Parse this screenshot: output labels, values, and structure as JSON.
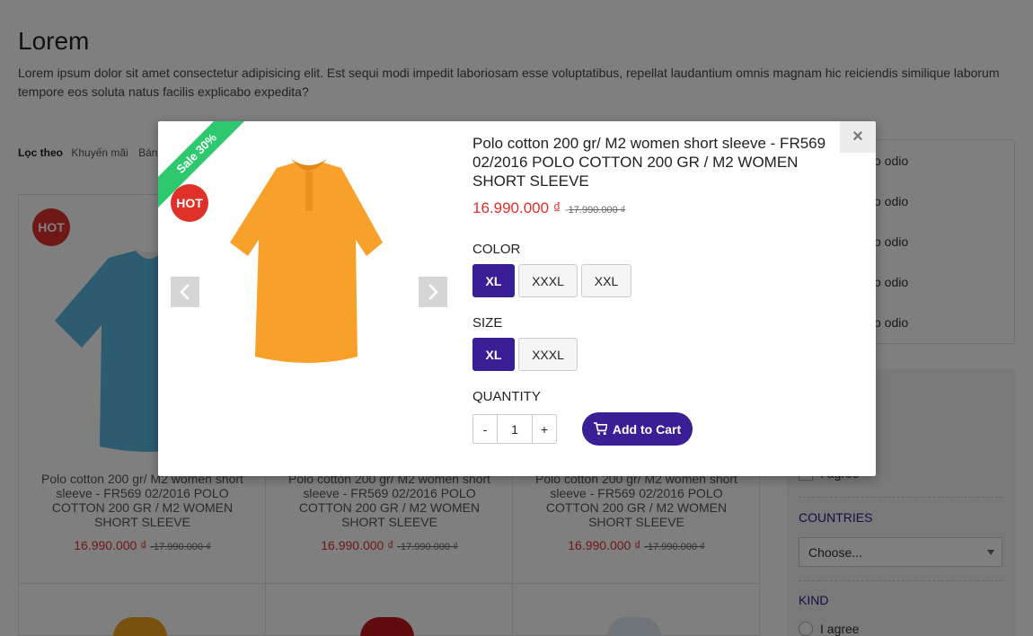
{
  "page": {
    "title": "Lorem",
    "description": "Lorem ipsum dolor sit amet consectetur adipisicing elit. Est sequi modi impedit laboriosam esse voluptatibus, repellat laudantium omnis magnam hic reiciendis similique laborum tempore eos soluta natus facilis explicabo expedita?"
  },
  "filter": {
    "label": "Lọc theo",
    "items": [
      "Khuyến mãi",
      "Bán c"
    ]
  },
  "products": [
    {
      "badge": "HOT",
      "name": "Polo cotton 200 gr/ M2 women short sleeve - FR569 02/2016 POLO COTTON 200 GR / M2 WOMEN SHORT SLEEVE",
      "price": "16.990.000 ₫",
      "sep": "-",
      "old_price": "17.990.000 ₫",
      "color": "#5bb7e0"
    },
    {
      "badge": "",
      "name": "Polo cotton 200 gr/ M2 women short sleeve - FR569 02/2016 POLO COTTON 200 GR / M2 WOMEN SHORT SLEEVE",
      "price": "16.990.000 ₫",
      "sep": "-",
      "old_price": "17.990.000 ₫",
      "color": "#cccccc"
    },
    {
      "badge": "",
      "name": "Polo cotton 200 gr/ M2 women short sleeve - FR569 02/2016 POLO COTTON 200 GR / M2 WOMEN SHORT SLEEVE",
      "price": "16.990.000 ₫",
      "sep": "-",
      "old_price": "17.990.000 ₫",
      "color": "#cccccc"
    }
  ],
  "sidebar": {
    "links": [
      "o odio",
      "o odio",
      "o odio",
      "o odio",
      "o odio"
    ],
    "agree_1": "I agree",
    "countries_heading": "COUNTRIES",
    "countries_select": "Choose...",
    "kind_heading": "KIND",
    "agree_2": "I agree"
  },
  "modal": {
    "close": "×",
    "ribbon": "Sale 30%",
    "badge": "HOT",
    "title": "Polo cotton 200 gr/ M2 women short sleeve - FR569 02/2016 POLO COTTON 200 GR / M2 WOMEN SHORT SLEEVE",
    "price": "16.990.000 ₫",
    "sep": "-",
    "old_price": "17.990.000 ₫",
    "color_label": "COLOR",
    "colors": [
      "XL",
      "XXXL",
      "XXL"
    ],
    "selected_color": "XL",
    "size_label": "SIZE",
    "sizes": [
      "XL",
      "XXXL"
    ],
    "selected_size": "XL",
    "quantity_label": "QUANTITY",
    "qty_minus": "-",
    "qty_value": "1",
    "qty_plus": "+",
    "add_to_cart": "Add to Cart",
    "accent_color": "#3a1e96",
    "sale_color": "#2ec86e",
    "price_color": "#e0302a"
  }
}
